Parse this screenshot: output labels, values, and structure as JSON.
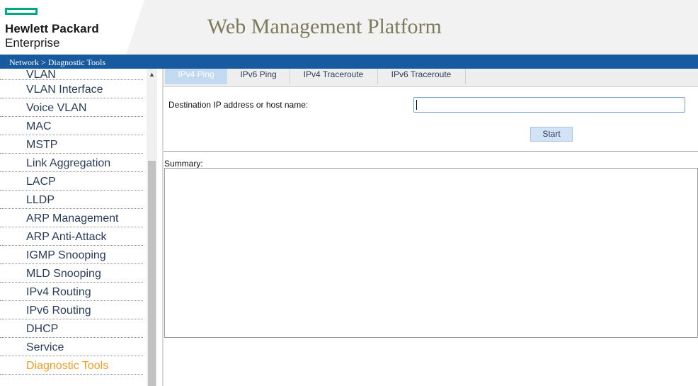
{
  "header": {
    "brand_line1": "Hewlett Packard",
    "brand_line2": "Enterprise",
    "app_title": "Web Management Platform",
    "brand_color": "#01a982"
  },
  "breadcrumb": "Network > Diagnostic Tools",
  "sidebar": {
    "items": [
      {
        "label": "VLAN"
      },
      {
        "label": "VLAN Interface"
      },
      {
        "label": "Voice VLAN"
      },
      {
        "label": "MAC"
      },
      {
        "label": "MSTP"
      },
      {
        "label": "Link Aggregation"
      },
      {
        "label": "LACP"
      },
      {
        "label": "LLDP"
      },
      {
        "label": "ARP Management"
      },
      {
        "label": "ARP Anti-Attack"
      },
      {
        "label": "IGMP Snooping"
      },
      {
        "label": "MLD Snooping"
      },
      {
        "label": "IPv4 Routing"
      },
      {
        "label": "IPv6 Routing"
      },
      {
        "label": "DHCP"
      },
      {
        "label": "Service"
      },
      {
        "label": "Diagnostic Tools"
      }
    ],
    "active_item": "Diagnostic Tools",
    "active_color": "#f39b20"
  },
  "tabs": [
    {
      "label": "IPv4 Ping",
      "selected": true
    },
    {
      "label": "IPv6 Ping",
      "selected": false
    },
    {
      "label": "IPv4 Traceroute",
      "selected": false
    },
    {
      "label": "IPv6 Traceroute",
      "selected": false
    }
  ],
  "form": {
    "destination_label": "Destination IP address or host name:",
    "destination_value": "",
    "start_label": "Start"
  },
  "summary": {
    "label": "Summary:",
    "content": ""
  }
}
